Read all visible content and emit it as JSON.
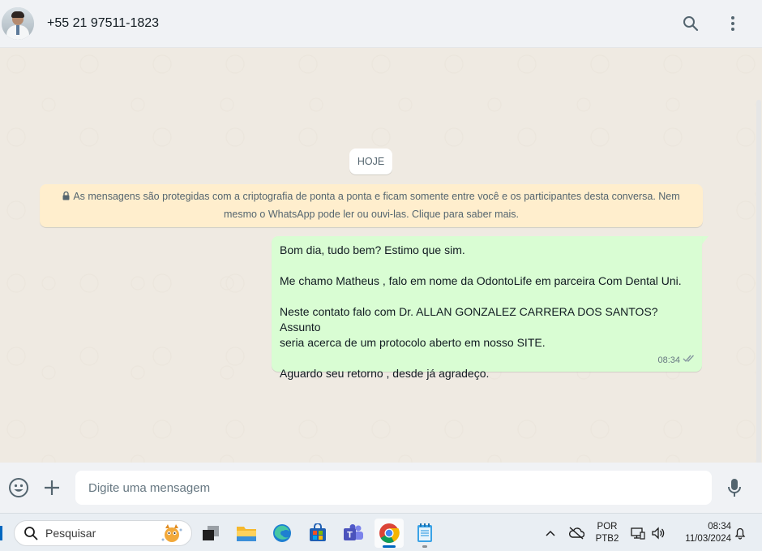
{
  "header": {
    "contact_name": "+55 21 97511-1823",
    "icons": [
      "avatar",
      "search-icon",
      "menu-icon"
    ]
  },
  "chat": {
    "date_chip": "HOJE",
    "encryption_notice_line1": "As mensagens são protegidas com a criptografia de ponta a ponta e ficam somente entre você e os participantes desta conversa. Nem",
    "encryption_notice_line2": "mesmo o WhatsApp pode ler ou ouvi-las. Clique para saber mais.",
    "message": {
      "lines": [
        "Bom dia, tudo bem? Estimo que sim.",
        "Me chamo Matheus , falo em nome da OdontoLife em parceira Com Dental Uni.",
        "Neste contato falo com Dr. ALLAN GONZALEZ CARRERA DOS SANTOS? Assunto",
        "seria acerca de um protocolo aberto em nosso SITE.",
        "Aguardo seu retorno , desde já agradeço."
      ],
      "time": "08:34",
      "status": "read",
      "bubble_color": "#d9fdd3"
    },
    "background_color": "#efeae2",
    "notice_color": "#ffeecd"
  },
  "composer": {
    "placeholder": "Digite uma mensagem",
    "value": ""
  },
  "taskbar": {
    "search_label": "Pesquisar",
    "apps": [
      "task-view",
      "file-explorer",
      "edge",
      "microsoft-store",
      "teams",
      "chrome",
      "notepad"
    ],
    "language_line1": "POR",
    "language_line2": "PTB2",
    "time": "08:34",
    "date": "11/03/2024"
  }
}
